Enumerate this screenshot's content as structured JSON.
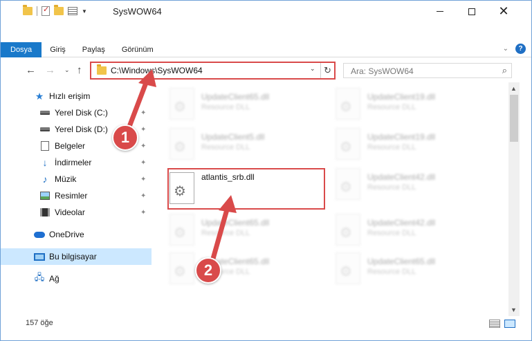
{
  "window": {
    "title": "SysWOW64",
    "minimize_icon": "minimize-icon",
    "maximize_icon": "maximize-icon",
    "close_glyph": "✕"
  },
  "ribbon": {
    "tabs": [
      "Dosya",
      "Giriş",
      "Paylaş",
      "Görünüm"
    ],
    "help_glyph": "?"
  },
  "nav": {
    "back_glyph": "←",
    "forward_glyph": "→",
    "recent_glyph": "⌄",
    "up_glyph": "↑"
  },
  "address": {
    "path": "C:\\Windows\\SysWOW64",
    "dropdown_glyph": "⌄",
    "refresh_glyph": "↻"
  },
  "search": {
    "placeholder": "Ara: SysWOW64",
    "icon_glyph": "⚲"
  },
  "sidebar": {
    "items": [
      {
        "label": "Hızlı erişim",
        "icon": "star-icon"
      },
      {
        "label": "Yerel Disk (C:)",
        "icon": "drive-icon",
        "pinned": true
      },
      {
        "label": "Yerel Disk (D:)",
        "icon": "drive-icon",
        "pinned": true
      },
      {
        "label": "Belgeler",
        "icon": "documents-icon",
        "pinned": true
      },
      {
        "label": "İndirmeler",
        "icon": "downloads-icon",
        "pinned": true
      },
      {
        "label": "Müzik",
        "icon": "music-icon",
        "pinned": true
      },
      {
        "label": "Resimler",
        "icon": "pictures-icon",
        "pinned": true
      },
      {
        "label": "Videolar",
        "icon": "videos-icon",
        "pinned": true
      },
      {
        "label": "OneDrive",
        "icon": "onedrive-icon"
      },
      {
        "label": "Bu bilgisayar",
        "icon": "this-pc-icon",
        "selected": true
      },
      {
        "label": "Ağ",
        "icon": "network-icon"
      }
    ],
    "pin_glyph": "📌"
  },
  "files": {
    "left_column": [
      {
        "name": "UpdateClient65.dll",
        "desc": "Resource DLL"
      },
      {
        "name": "UpdateClient5.dll",
        "desc": "Resource DLL"
      },
      {
        "name": "atlantis_srb.dll",
        "desc": ""
      },
      {
        "name": "UpdateClient65.dll",
        "desc": "Resource DLL"
      },
      {
        "name": "UpdateClient65.dll",
        "desc": "Resource DLL"
      }
    ],
    "right_column": [
      {
        "name": "UpdateClient19.dll",
        "desc": "Resource DLL"
      },
      {
        "name": "UpdateClient19.dll",
        "desc": "Resource DLL"
      },
      {
        "name": "UpdateClient42.dll",
        "desc": "Resource DLL"
      },
      {
        "name": "UpdateClient42.dll",
        "desc": "Resource DLL"
      },
      {
        "name": "UpdateClient65.dll",
        "desc": "Resource DLL"
      }
    ],
    "gear_glyph": "⚙"
  },
  "status": {
    "count": "157 öğe"
  },
  "annotations": {
    "step1": "1",
    "step2": "2",
    "color": "#d94a4a"
  },
  "colors": {
    "file_tab": "#1979ca",
    "selected_nav": "#cce8ff",
    "highlight": "#d94a4a"
  }
}
